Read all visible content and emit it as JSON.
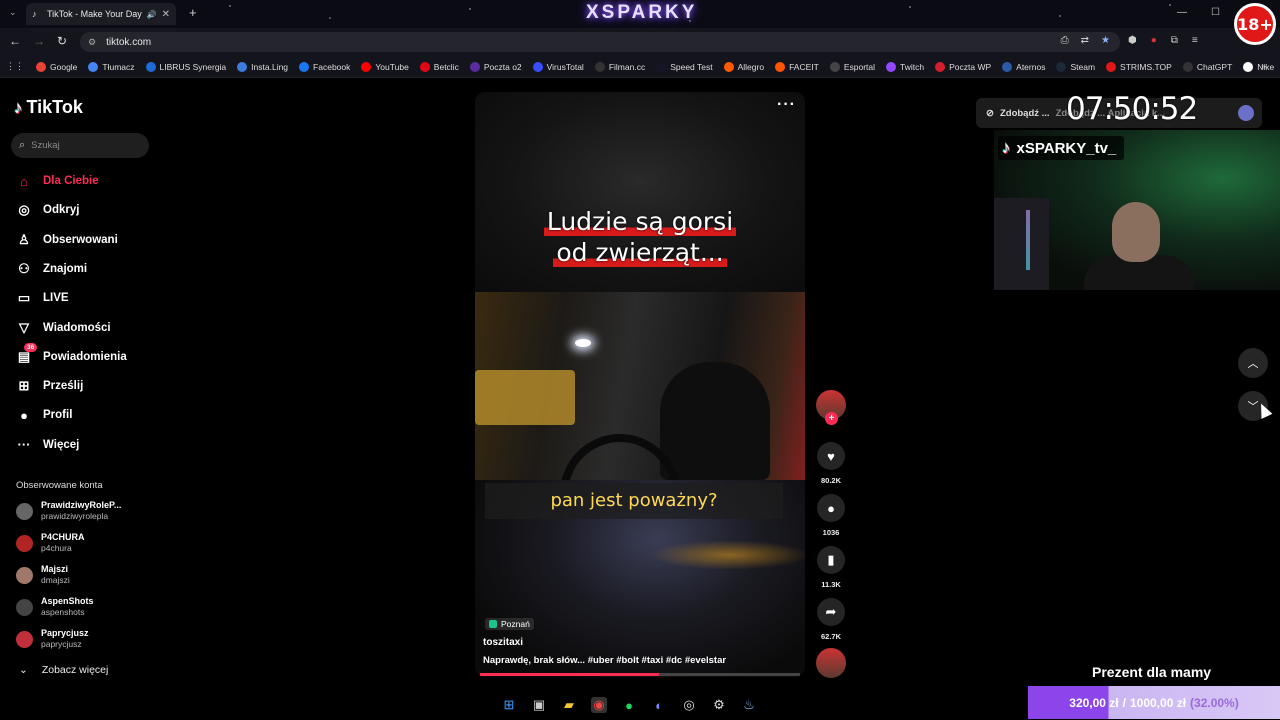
{
  "browser": {
    "tab_title": "TikTok - Make Your Day",
    "url": "tiktok.com",
    "brand_overlay": "XSPARKY",
    "age_badge": "18+",
    "bookmarks": [
      {
        "label": "Google",
        "color": "#ea4335"
      },
      {
        "label": "Tłumacz",
        "color": "#4285f4"
      },
      {
        "label": "LIBRUS Synergia",
        "color": "#1e6bd6"
      },
      {
        "label": "Insta.Ling",
        "color": "#3b7ddd"
      },
      {
        "label": "Facebook",
        "color": "#1877f2"
      },
      {
        "label": "YouTube",
        "color": "#ff0000"
      },
      {
        "label": "Betclic",
        "color": "#e30613"
      },
      {
        "label": "Poczta o2",
        "color": "#5a2ca0"
      },
      {
        "label": "VirusTotal",
        "color": "#394eff"
      },
      {
        "label": "Filman.cc",
        "color": "#333333"
      },
      {
        "label": "Speed Test",
        "color": "#141526"
      },
      {
        "label": "Allegro",
        "color": "#ff5a00"
      },
      {
        "label": "FACEIT",
        "color": "#ff5500"
      },
      {
        "label": "Esportal",
        "color": "#444444"
      },
      {
        "label": "Twitch",
        "color": "#9146ff"
      },
      {
        "label": "Poczta WP",
        "color": "#d31f2d"
      },
      {
        "label": "Aternos",
        "color": "#2b5ba8"
      },
      {
        "label": "Steam",
        "color": "#1b2838"
      },
      {
        "label": "STRIMS.TOP",
        "color": "#e01818"
      },
      {
        "label": "ChatGPT",
        "color": "#333333"
      },
      {
        "label": "Nike",
        "color": "#ffffff"
      }
    ]
  },
  "sidebar": {
    "logo": "TikTok",
    "search_placeholder": "Szukaj",
    "menu": [
      {
        "label": "Dla Ciebie",
        "icon": "home-icon",
        "active": true
      },
      {
        "label": "Odkryj",
        "icon": "compass-icon"
      },
      {
        "label": "Obserwowani",
        "icon": "following-icon"
      },
      {
        "label": "Znajomi",
        "icon": "friends-icon"
      },
      {
        "label": "LIVE",
        "icon": "live-icon"
      },
      {
        "label": "Wiadomości",
        "icon": "messages-icon"
      },
      {
        "label": "Powiadomienia",
        "icon": "notifications-icon",
        "count": "36"
      },
      {
        "label": "Prześlij",
        "icon": "upload-icon"
      },
      {
        "label": "Profil",
        "icon": "profile-icon"
      },
      {
        "label": "Więcej",
        "icon": "more-icon"
      }
    ],
    "followed_title": "Obserwowane konta",
    "followed": [
      {
        "name": "PrawidziwyRoleP...",
        "handle": "prawidziwyrolepla",
        "color": "#666"
      },
      {
        "name": "P4CHURA",
        "handle": "p4chura",
        "color": "#b02424"
      },
      {
        "name": "Majszi",
        "handle": "dmajszi",
        "color": "#a0786a"
      },
      {
        "name": "AspenShots",
        "handle": "aspenshots",
        "color": "#444"
      },
      {
        "name": "Paprycjusz",
        "handle": "paprycjusz",
        "color": "#c0303a"
      }
    ],
    "see_more": "Zobacz więcej"
  },
  "video": {
    "caption_top_line1": "Ludzie są gorsi",
    "caption_top_line2": "od zwierząt...",
    "caption_mid": "pan jest poważny?",
    "location": "Poznań",
    "author": "toszitaxi",
    "description": "Naprawdę, brak słów... #uber #bolt  #taxi #dc #evelstar",
    "progress": 0.56,
    "likes": "80.2K",
    "comments": "1036",
    "saves": "11.3K",
    "shares": "62.7K"
  },
  "stream_overlay": {
    "pill_left": "Zdobądź ...",
    "pill_right": "Zdobądź ... Aplikacja k...",
    "clock": "07:50:52",
    "cam_name": "xSPARKY_tv_",
    "gift_title": "Prezent dla mamy",
    "gift_current": "320,00 zł",
    "gift_separator": "/",
    "gift_goal": "1000,00 zł",
    "gift_percent": "(32.00%)",
    "gift_fraction": 0.32
  }
}
